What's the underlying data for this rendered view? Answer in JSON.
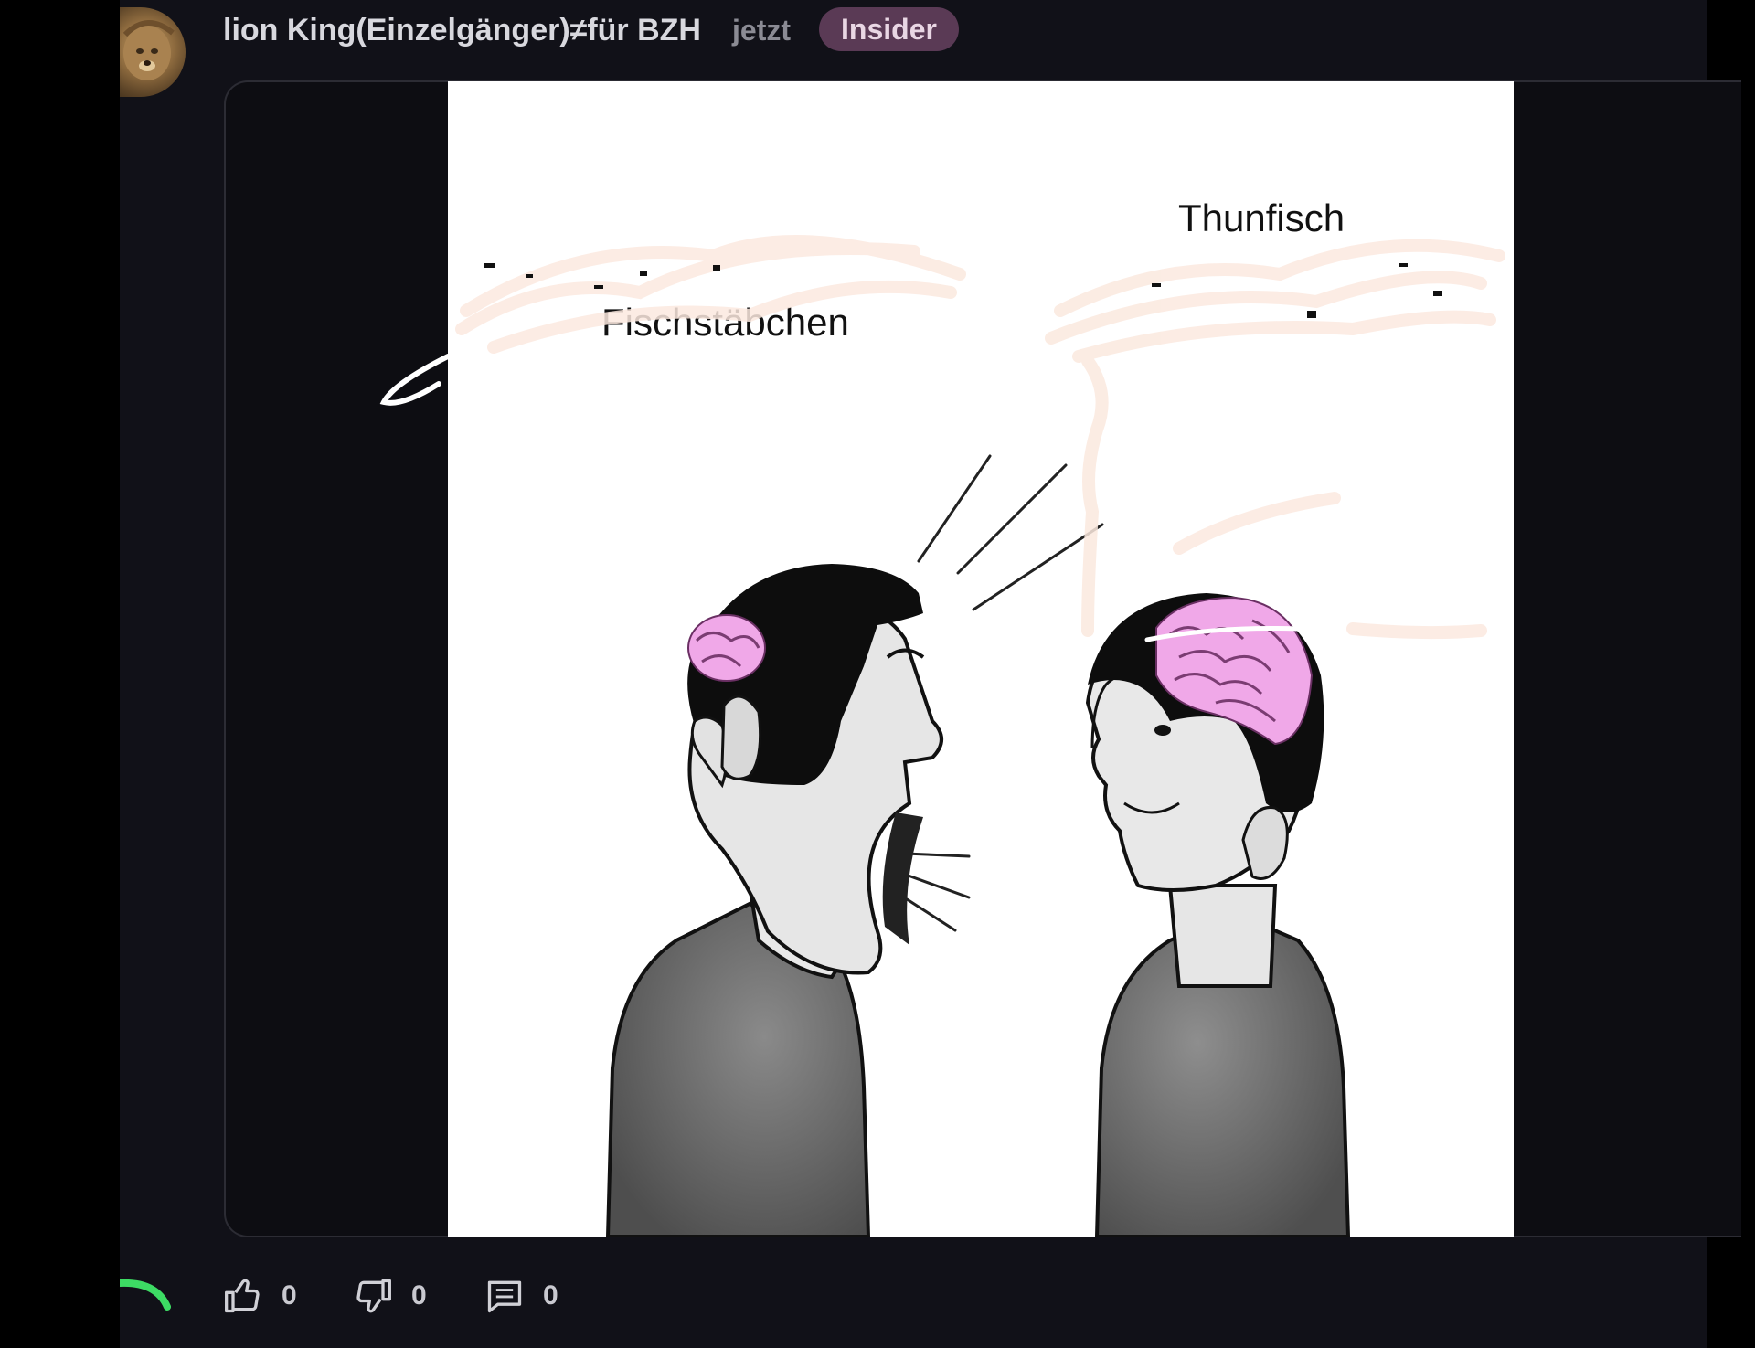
{
  "post": {
    "username": "lion King(Einzelgänger)≠für BZH",
    "timestamp": "jetzt",
    "badge": "Insider",
    "image": {
      "label_left": "Fischstäbchen",
      "label_right": "Thunfisch"
    }
  },
  "actions": {
    "likes": "0",
    "dislikes": "0",
    "comments": "0"
  },
  "icons": [
    "like-icon",
    "dislike-icon",
    "comment-icon",
    "loading-spinner-icon"
  ],
  "colors": {
    "background": "#111118",
    "badge_bg": "#5a3a55",
    "brain": "#f0a8e8",
    "spinner": "#3ddc64"
  }
}
